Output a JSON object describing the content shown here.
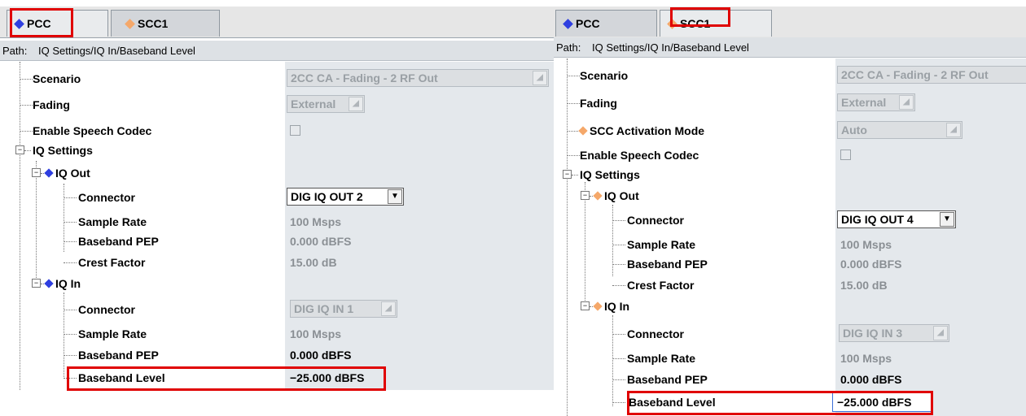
{
  "left": {
    "tabs": [
      {
        "label": "PCC"
      },
      {
        "label": "SCC1"
      }
    ],
    "path_label": "Path:",
    "path_value": "IQ Settings/IQ In/Baseband Level",
    "rows": {
      "scenario": {
        "label": "Scenario",
        "value": "2CC CA - Fading - 2 RF Out"
      },
      "fading": {
        "label": "Fading",
        "value": "External"
      },
      "speech": {
        "label": "Enable Speech Codec"
      },
      "iq_settings": {
        "label": "IQ Settings"
      },
      "iq_out": {
        "label": "IQ Out"
      },
      "out_connector": {
        "label": "Connector",
        "value": "DIG IQ OUT 2"
      },
      "out_sample_rate": {
        "label": "Sample Rate",
        "value": "100 Msps"
      },
      "out_pep": {
        "label": "Baseband PEP",
        "value": "0.000 dBFS"
      },
      "out_crest": {
        "label": "Crest Factor",
        "value": "15.00 dB"
      },
      "iq_in": {
        "label": "IQ In"
      },
      "in_connector": {
        "label": "Connector",
        "value": "DIG IQ IN 1"
      },
      "in_sample_rate": {
        "label": "Sample Rate",
        "value": "100 Msps"
      },
      "in_pep": {
        "label": "Baseband PEP",
        "value": "0.000 dBFS"
      },
      "in_level": {
        "label": "Baseband Level",
        "value": "−25.000 dBFS"
      }
    }
  },
  "right": {
    "tabs": [
      {
        "label": "PCC"
      },
      {
        "label": "SCC1"
      }
    ],
    "path_label": "Path:",
    "path_value": "IQ Settings/IQ In/Baseband Level",
    "rows": {
      "scenario": {
        "label": "Scenario",
        "value": "2CC CA - Fading - 2 RF Out"
      },
      "fading": {
        "label": "Fading",
        "value": "External"
      },
      "activation": {
        "label": "SCC Activation Mode",
        "value": "Auto"
      },
      "speech": {
        "label": "Enable Speech Codec"
      },
      "iq_settings": {
        "label": "IQ Settings"
      },
      "iq_out": {
        "label": "IQ Out"
      },
      "out_connector": {
        "label": "Connector",
        "value": "DIG IQ OUT 4"
      },
      "out_sample_rate": {
        "label": "Sample Rate",
        "value": "100 Msps"
      },
      "out_pep": {
        "label": "Baseband PEP",
        "value": "0.000 dBFS"
      },
      "out_crest": {
        "label": "Crest Factor",
        "value": "15.00 dB"
      },
      "iq_in": {
        "label": "IQ In"
      },
      "in_connector": {
        "label": "Connector",
        "value": "DIG IQ IN 3"
      },
      "in_sample_rate": {
        "label": "Sample Rate",
        "value": "100 Msps"
      },
      "in_pep": {
        "label": "Baseband PEP",
        "value": "0.000 dBFS"
      },
      "in_level": {
        "label": "Baseband Level",
        "value": "−25.000 dBFS"
      }
    }
  },
  "colors": {
    "pcc_marker": "#2f3fe0",
    "scc_marker": "#f5a86a",
    "highlight": "#e00000"
  },
  "icons": [
    "diamond-icon",
    "dropdown-arrow-icon",
    "tree-expander-icon",
    "checkbox"
  ]
}
